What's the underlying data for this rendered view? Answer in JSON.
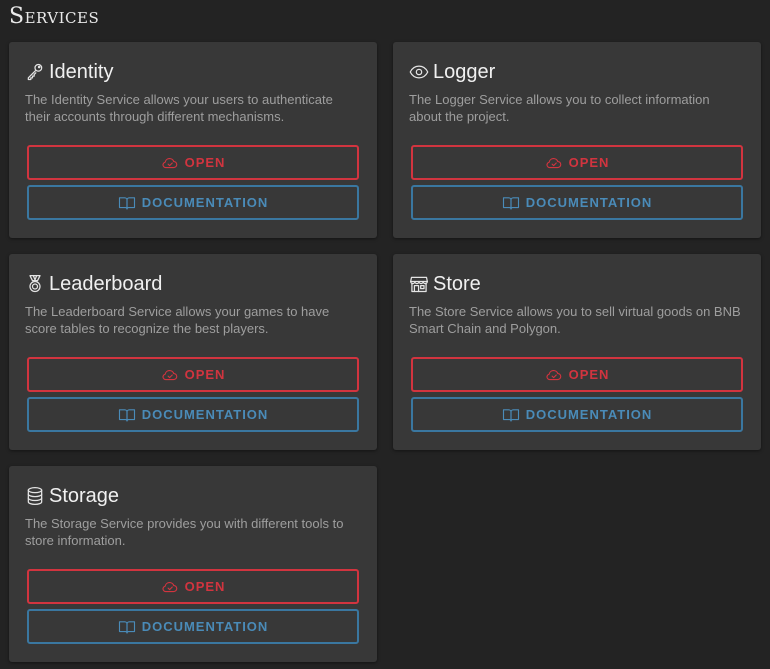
{
  "page": {
    "title": "Services"
  },
  "colors": {
    "background": "#232323",
    "card": "#383838",
    "open_accent": "#d2343f",
    "docs_accent": "#3a77a0"
  },
  "services": [
    {
      "title": "Identity",
      "icon": "key-icon",
      "description": "The Identity Service allows your users to authenticate their accounts through different mechanisms.",
      "open_label": "OPEN",
      "docs_label": "DOCUMENTATION"
    },
    {
      "title": "Logger",
      "icon": "eye-icon",
      "description": "The Logger Service allows you to collect information about the project.",
      "open_label": "OPEN",
      "docs_label": "DOCUMENTATION"
    },
    {
      "title": "Leaderboard",
      "icon": "medal-icon",
      "description": "The Leaderboard Service allows your games to have score tables to recognize the best players.",
      "open_label": "OPEN",
      "docs_label": "DOCUMENTATION"
    },
    {
      "title": "Store",
      "icon": "store-icon",
      "description": "The Store Service allows you to sell virtual goods on BNB Smart Chain and Polygon.",
      "open_label": "OPEN",
      "docs_label": "DOCUMENTATION"
    },
    {
      "title": "Storage",
      "icon": "database-icon",
      "description": "The Storage Service provides you with different tools to store information.",
      "open_label": "OPEN",
      "docs_label": "DOCUMENTATION"
    }
  ]
}
